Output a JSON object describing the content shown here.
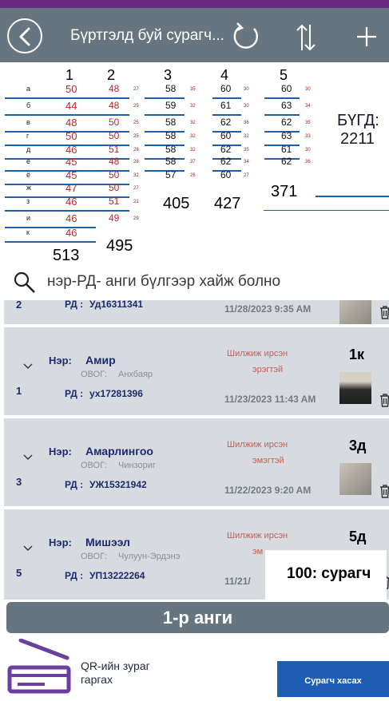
{
  "header": {
    "title": "Бүртгэлд буй сурагч...",
    "back_icon": "arrow-left-circle-icon",
    "refresh_icon": "refresh-icon",
    "sort_icon": "sort-arrows-icon",
    "add_icon": "plus-icon"
  },
  "stats": {
    "columns": [
      {
        "header": "1",
        "values": [
          "50",
          "44",
          "48",
          "50",
          "46",
          "45",
          "45",
          "47",
          "46",
          "46",
          "46"
        ],
        "total": "513",
        "row_labels": [
          "а",
          "б",
          "в",
          "г",
          "д",
          "е",
          "ё",
          "ж",
          "з",
          "и",
          "к"
        ]
      },
      {
        "header": "2",
        "values": [
          "48",
          "48",
          "50",
          "50",
          "51",
          "48",
          "50",
          "50",
          "51",
          "49"
        ],
        "small": [
          "27",
          "25",
          "25",
          "25",
          "28",
          "28",
          "32",
          "27",
          "21",
          "29"
        ],
        "total": "495"
      },
      {
        "header": "3",
        "values": [
          "58",
          "59",
          "58",
          "58",
          "58",
          "58",
          "57"
        ],
        "small": [
          "35",
          "32",
          "32",
          "32",
          "32",
          "37",
          "26"
        ],
        "total": "405"
      },
      {
        "header": "4",
        "values": [
          "60",
          "61",
          "62",
          "60",
          "62",
          "62",
          "60"
        ],
        "small": [
          "30",
          "30",
          "36",
          "32",
          "35",
          "34",
          "27"
        ],
        "total": "427"
      },
      {
        "header": "5",
        "values": [
          "60",
          "63",
          "62",
          "63",
          "61",
          "62"
        ],
        "small": [
          "30",
          "34",
          "35",
          "33",
          "30",
          "36"
        ],
        "total": "371"
      }
    ],
    "grand_total_label": "БҮГД:",
    "grand_total_value": "2211"
  },
  "search": {
    "icon": "magnifier-icon",
    "placeholder": "нэр-РД- анги бүлгээр хайж болно"
  },
  "students": [
    {
      "index": "2",
      "name_label": "",
      "name": "",
      "surname_label": "",
      "surname": "",
      "rd_label": "РД :",
      "rd": "Уд16311341",
      "status": "",
      "gender": "",
      "grade": "",
      "datetime": "11/28/2023 9:35 AM"
    },
    {
      "index": "1",
      "name_label": "Нэр:",
      "name": "Амир",
      "surname_label": "ОВОГ:",
      "surname": "Анхбаяр",
      "rd_label": "РД :",
      "rd": "ух17281396",
      "status": "Шилжиж ирсэн",
      "gender": "эрэгтэй",
      "grade": "1к",
      "datetime": "11/23/2023 11:43 AM"
    },
    {
      "index": "3",
      "name_label": "Нэр:",
      "name": "Амарлингоо",
      "surname_label": "ОВОГ:",
      "surname": "Чинзориг",
      "rd_label": "РД :",
      "rd": "УЖ15321942",
      "status": "Шилжиж ирсэн",
      "gender": "эмэгтэй",
      "grade": "3д",
      "datetime": "11/22/2023 9:20 AM"
    },
    {
      "index": "5",
      "name_label": "Нэр:",
      "name": "Мишээл",
      "surname_label": "ОВОГ:",
      "surname": "Чулуун-Эрдэнэ",
      "rd_label": "РД :",
      "rd": "УП13222264",
      "status": "Шилжиж ирсэн",
      "gender": "эм",
      "grade": "5д",
      "datetime": "11/21/"
    }
  ],
  "student_count": "100: сурагч",
  "class_bar": "1-р анги",
  "qr": {
    "label_line1": "QR-ийн зураг",
    "label_line2": "гаргах",
    "icon": "scanner-icon"
  },
  "remove_button": "Сурагч хасах",
  "colors": {
    "header": "#677581",
    "topbar": "#6a2a84",
    "accent_red": "#c0392b",
    "navy": "#1c2a6e",
    "button": "#1e5db4",
    "card": "#d7dbdf"
  }
}
